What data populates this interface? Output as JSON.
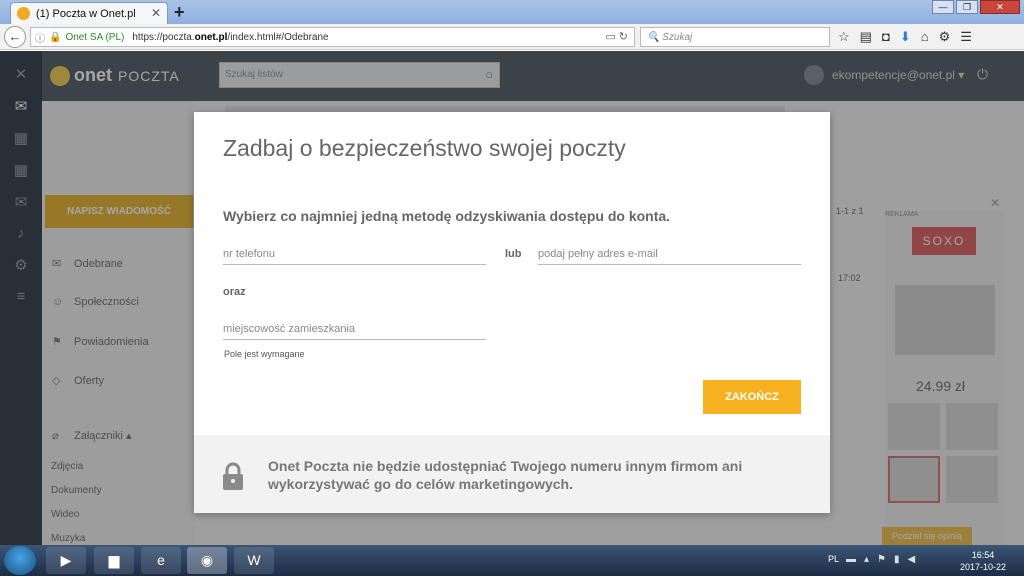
{
  "browser": {
    "tab_title": "(1) Poczta w Onet.pl",
    "tab_close": "✕",
    "new_tab": "+",
    "ssl_owner": "Onet SA (PL)",
    "url_prefix": "https://poczta.",
    "url_domain": "onet.pl",
    "url_suffix": "/index.html#/Odebrane",
    "search_placeholder": "Szukaj"
  },
  "app": {
    "logo_text": "onet",
    "logo_product": "POCZTA",
    "search_placeholder": "Szukaj listów",
    "user_email": "ekompetencje@onet.pl",
    "compose_label": "NAPISZ WIADOMOŚĆ",
    "nav": [
      {
        "label": "Odebrane"
      },
      {
        "label": "Społeczności"
      },
      {
        "label": "Powiadomienia"
      },
      {
        "label": "Oferty"
      },
      {
        "label": "Załączniki"
      }
    ],
    "attachments": [
      "Zdjęcia",
      "Dokumenty",
      "Wideo",
      "Muzyka"
    ],
    "pagination": "1-1 z 1",
    "mail_time": "17:02"
  },
  "ad": {
    "label": "REKLAMA",
    "brand": "SOXO",
    "price": "24.99 zł",
    "share": "Podziel się opinią"
  },
  "modal": {
    "title": "Zadbaj o bezpieczeństwo swojej poczty",
    "subtitle": "Wybierz co najmniej jedną metodę odzyskiwania dostępu do konta.",
    "phone_placeholder": "nr telefonu",
    "or_label": "lub",
    "email_placeholder": "podaj pełny adres e-mail",
    "and_label": "oraz",
    "city_placeholder": "miejscowość zamieszkania",
    "required_note": "Pole jest wymagane",
    "finish_button": "ZAKOŃCZ",
    "footer_note": "Onet Poczta nie będzie udostępniać Twojego numeru innym firmom ani wykorzystywać go do celów marketingowych."
  },
  "taskbar": {
    "lang": "PL",
    "time": "16:54",
    "date": "2017-10-22"
  }
}
